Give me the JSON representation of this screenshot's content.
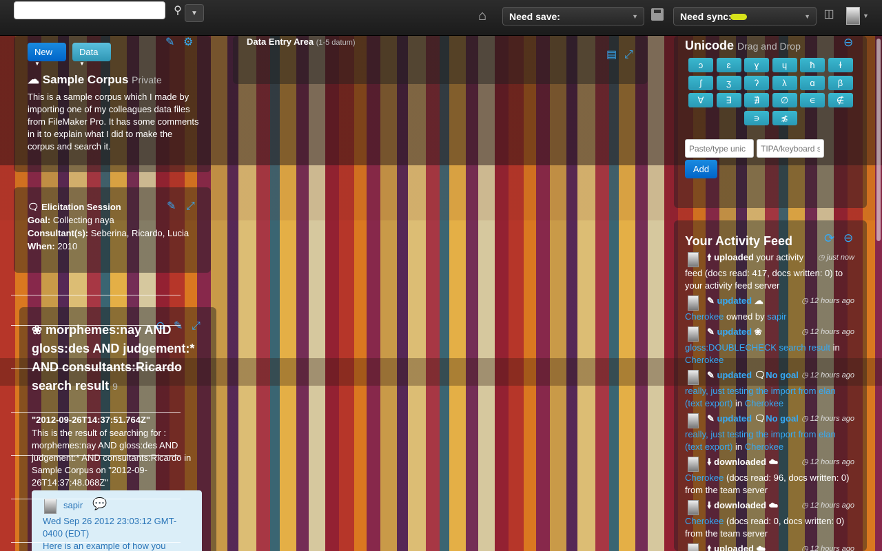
{
  "topbar": {
    "search_placeholder": "",
    "save_label": "Need save:",
    "sync_label": "Need sync:"
  },
  "corpus": {
    "new_label": "New",
    "data_label": "Data",
    "title": "Sample Corpus",
    "privacy": "Private",
    "description": "This is a sample corpus which I made by importing one of my colleagues data files from FileMaker Pro. It has some comments in it to explain what I did to make the corpus and search it."
  },
  "session": {
    "title": "Elicitation Session",
    "goal_label": "Goal:",
    "goal_value": "Collecting naya",
    "consultants_label": "Consultant(s):",
    "consultants_value": "Seberina, Ricardo, Lucia",
    "when_label": "When:",
    "when_value": "2010"
  },
  "search": {
    "title": "morphemes:nay AND gloss:des AND judgement:* AND consultants:Ricardo search result",
    "count": "9",
    "timestamp": "\"2012-09-26T14:37:51.764Z\"",
    "description": "This is the result of searching for : morphemes:nay AND gloss:des AND judgement:* AND consultants:Ricardo in Sample Corpus on \"2012-09-26T14:37:48.068Z\"",
    "comment": {
      "user": "sapir",
      "date": "Wed Sep 26 2012 23:03:12 GMT-0400 (EDT)",
      "text": "Here is an example of how you"
    }
  },
  "data_entry": {
    "title": "Data Entry Area",
    "subtitle": "(1-5 datum)"
  },
  "unicode": {
    "title": "Unicode",
    "subtitle": "Drag and Drop",
    "keys": [
      "ɔ",
      "ɛ",
      "ɣ",
      "ɥ",
      "ħ",
      "ɫ",
      "ʃ",
      "ʒ",
      "ʔ",
      "λ",
      "ɑ",
      "β",
      "∀",
      "∃",
      "∄",
      "∅",
      "∊",
      "∉",
      "∍",
      "≴"
    ],
    "paste_placeholder": "Paste/type unic",
    "tipa_placeholder": "TIPA/keyboard s",
    "add_label": "Add"
  },
  "activity": {
    "title": "Your Activity Feed",
    "items": [
      {
        "verb": "uploaded",
        "time": "just now",
        "line1_rest": "your activity",
        "body": "feed (docs read: 417, docs written: 0) to your activity feed server"
      },
      {
        "verb": "updated",
        "time": "12 hours ago",
        "link": "Cherokee",
        "body_rest": "owned by",
        "link2": "sapir"
      },
      {
        "verb": "updated",
        "time": "12 hours ago",
        "link": "gloss:DOUBLECHECK search result",
        "body_rest": "in",
        "link2": "Cherokee"
      },
      {
        "verb": "updated",
        "time": "12 hours ago",
        "extra": "No goal",
        "link": "really, just testing the import from elan (text export)",
        "body_rest": "in",
        "link2": "Cherokee"
      },
      {
        "verb": "updated",
        "time": "12 hours ago",
        "extra": "No goal",
        "link": "really, just testing the import from elan (text export)",
        "body_rest": "in",
        "link2": "Cherokee"
      },
      {
        "verb": "downloaded",
        "time": "12 hours ago",
        "link": "Cherokee",
        "body_rest": "(docs read: 96, docs written: 0) from the team server"
      },
      {
        "verb": "downloaded",
        "time": "12 hours ago",
        "link": "Cherokee",
        "body_rest": "(docs read: 0, docs written: 0) from the team server"
      },
      {
        "verb": "uploaded",
        "time": "12 hours ago"
      }
    ]
  }
}
